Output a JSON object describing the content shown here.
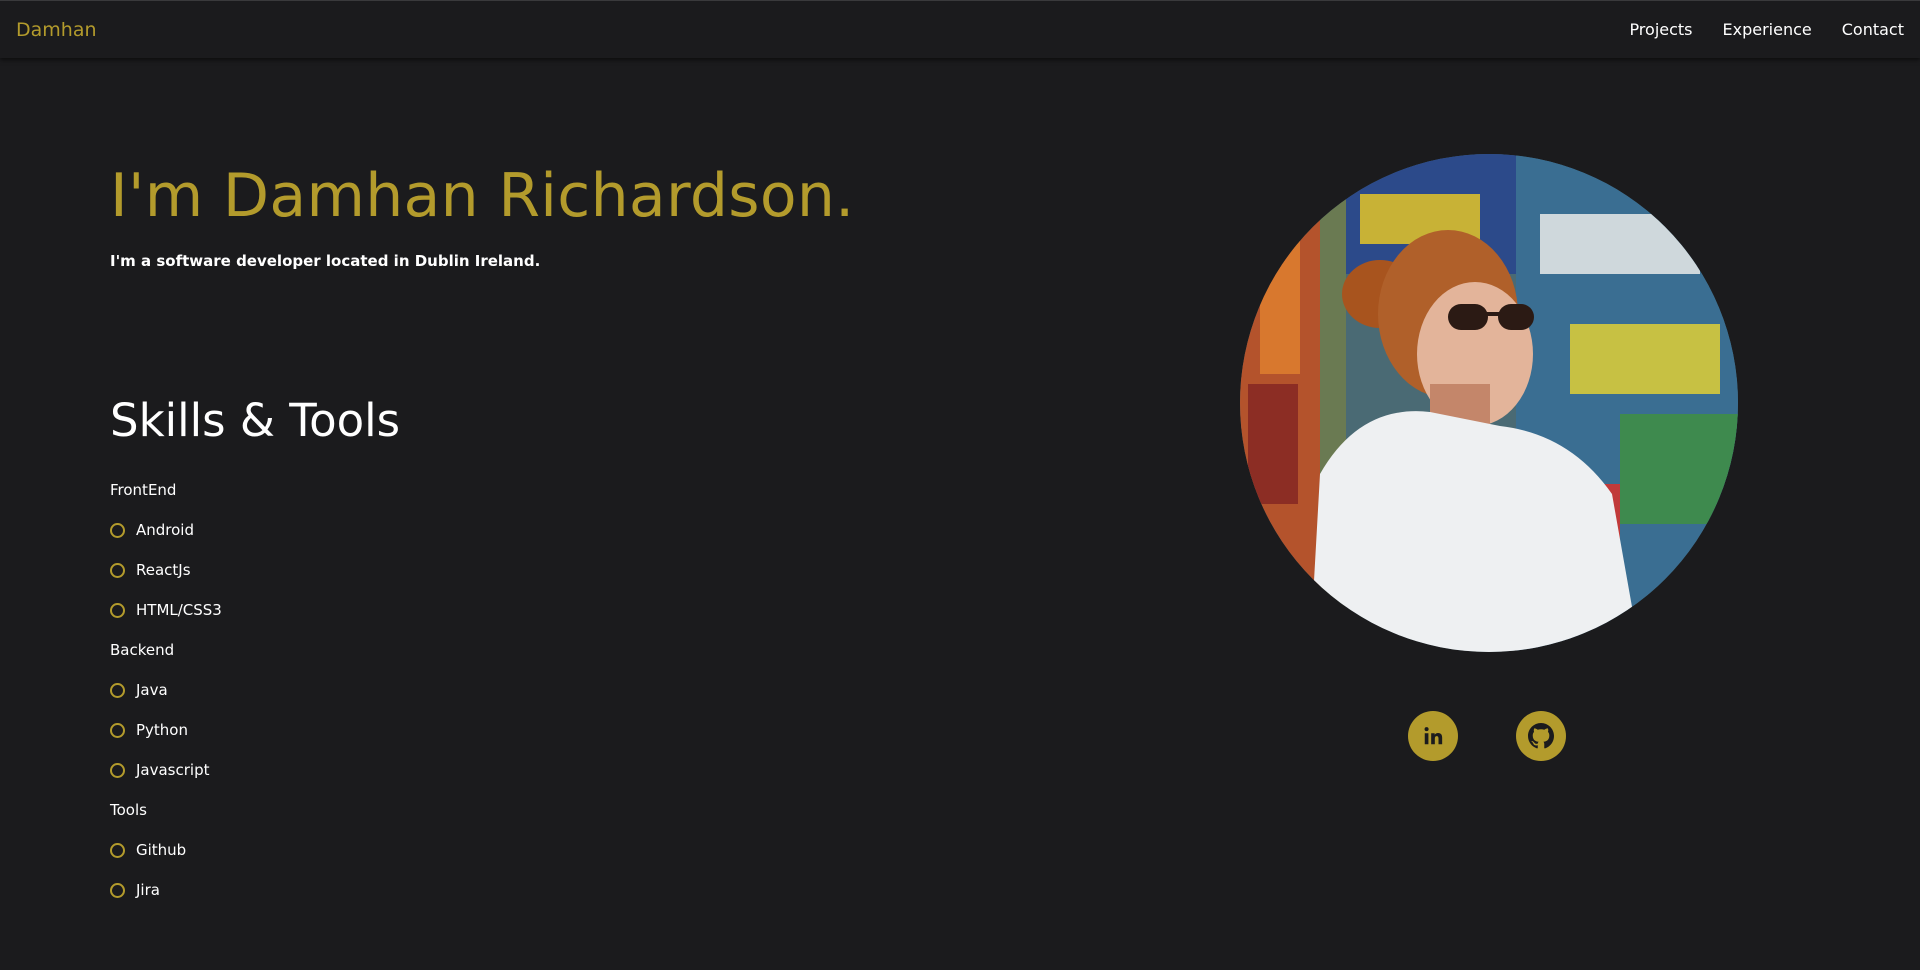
{
  "nav": {
    "brand": "Damhan",
    "links": [
      {
        "label": "Projects"
      },
      {
        "label": "Experience"
      },
      {
        "label": "Contact"
      }
    ]
  },
  "hero": {
    "title": "I'm Damhan Richardson.",
    "subtitle": "I'm a software developer located in Dublin Ireland."
  },
  "skills": {
    "heading": "Skills & Tools",
    "groups": [
      {
        "category": "FrontEnd",
        "items": [
          "Android",
          "ReactJs",
          "HTML/CSS3"
        ]
      },
      {
        "category": "Backend",
        "items": [
          "Java",
          "Python",
          "Javascript"
        ]
      },
      {
        "category": "Tools",
        "items": [
          "Github",
          "Jira"
        ]
      }
    ]
  },
  "social": [
    {
      "icon": "linkedin-icon"
    },
    {
      "icon": "github-icon"
    }
  ],
  "colors": {
    "background": "#1b1b1d",
    "accent": "#b39b2c",
    "text": "#ffffff"
  }
}
